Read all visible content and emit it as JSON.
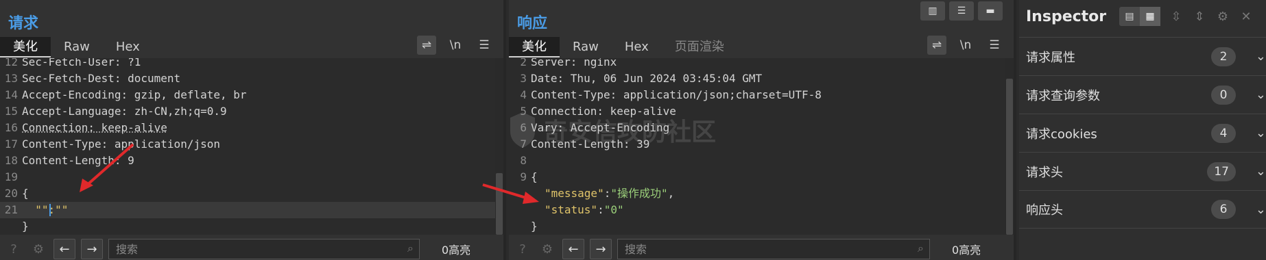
{
  "request": {
    "title": "请求",
    "tabs": [
      "美化",
      "Raw",
      "Hex"
    ],
    "tools": {
      "newline_label": "\\n"
    },
    "lines": [
      {
        "n": "12",
        "t": "Sec-Fetch-User: ?1"
      },
      {
        "n": "13",
        "t": "Sec-Fetch-Dest: document"
      },
      {
        "n": "14",
        "t": "Accept-Encoding: gzip, deflate, br"
      },
      {
        "n": "15",
        "t": "Accept-Language: zh-CN,zh;q=0.9"
      },
      {
        "n": "16",
        "t": "Connection: keep-alive"
      },
      {
        "n": "17",
        "t": "Content-Type: application/json"
      },
      {
        "n": "18",
        "t": "Content-Length: 9"
      },
      {
        "n": "19",
        "t": ""
      },
      {
        "n": "20",
        "t": "{"
      },
      {
        "n": "21",
        "t": "  \"\":\"\""
      },
      {
        "n": "",
        "t": "}"
      }
    ],
    "search": {
      "placeholder": "搜索",
      "count": "0高亮"
    }
  },
  "response": {
    "title": "响应",
    "tabs": [
      "美化",
      "Raw",
      "Hex",
      "页面渲染"
    ],
    "tools": {
      "newline_label": "\\n"
    },
    "lines": [
      {
        "n": "2",
        "t": "Server: nginx"
      },
      {
        "n": "3",
        "t": "Date: Thu, 06 Jun 2024 03:45:04 GMT"
      },
      {
        "n": "4",
        "t": "Content-Type: application/json;charset=UTF-8"
      },
      {
        "n": "5",
        "t": "Connection: keep-alive"
      },
      {
        "n": "6",
        "t": "Vary: Accept-Encoding"
      },
      {
        "n": "7",
        "t": "Content-Length: 39"
      },
      {
        "n": "8",
        "t": ""
      },
      {
        "n": "9",
        "t": "{"
      }
    ],
    "json_body": [
      {
        "key": "\"message\"",
        "value": "\"操作成功\"",
        "trail": ","
      },
      {
        "key": "\"status\"",
        "value": "\"0\"",
        "trail": ""
      }
    ],
    "closing": "}",
    "search": {
      "placeholder": "搜索",
      "count": "0高亮"
    }
  },
  "inspector": {
    "title": "Inspector",
    "sections": [
      {
        "label": "请求属性",
        "count": "2"
      },
      {
        "label": "请求查询参数",
        "count": "0"
      },
      {
        "label": "请求cookies",
        "count": "4"
      },
      {
        "label": "请求头",
        "count": "17"
      },
      {
        "label": "响应头",
        "count": "6"
      }
    ]
  },
  "watermark": "奇安信攻防社区",
  "colors": {
    "accent": "#4a9ce6",
    "json_key": "#e0c46a",
    "json_value": "#9bcf7a",
    "arrow": "#e0292b"
  }
}
